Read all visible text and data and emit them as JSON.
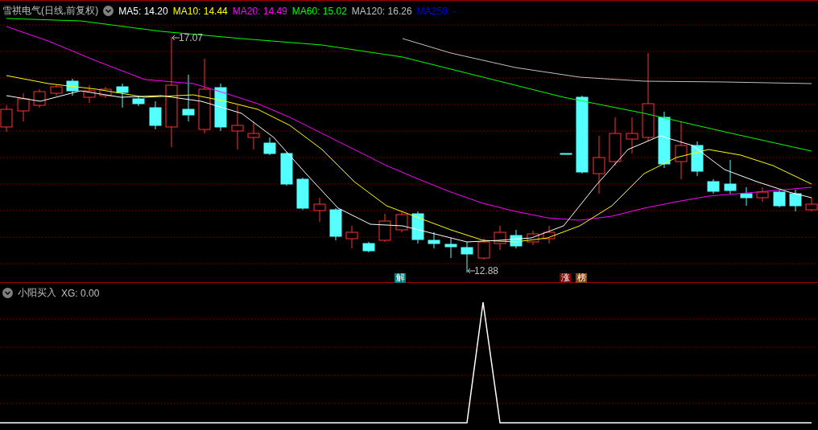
{
  "header": {
    "title": "雪祺电气(日线,前复权)",
    "ma": [
      {
        "label": "MA5: 14.20",
        "color": "#ffffff"
      },
      {
        "label": "MA10: 14.44",
        "color": "#ffff00"
      },
      {
        "label": "MA20: 14.49",
        "color": "#ff00ff"
      },
      {
        "label": "MA60: 15.02",
        "color": "#00ff00"
      },
      {
        "label": "MA120: 16.26",
        "color": "#c0c0c0"
      },
      {
        "label": "MA250: -",
        "color": "#0000ff"
      }
    ]
  },
  "price_marks": [
    {
      "text": "17.07"
    },
    {
      "text": "12.88"
    }
  ],
  "badges": [
    {
      "text": "解",
      "color": "#008080"
    },
    {
      "text": "涨",
      "color": "#8b0000"
    },
    {
      "text": "榜",
      "color": "#8b4513"
    }
  ],
  "indicator": {
    "title": "小阳买入",
    "reading": "XG: 0.00"
  }
}
